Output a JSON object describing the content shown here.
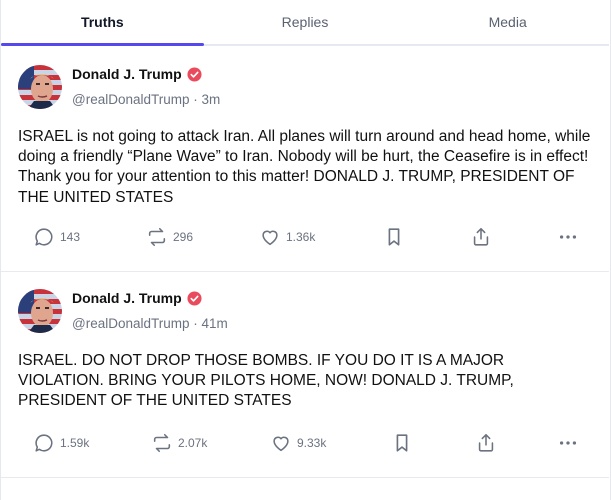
{
  "tabs": [
    {
      "label": "Truths",
      "active": true
    },
    {
      "label": "Replies",
      "active": false
    },
    {
      "label": "Media",
      "active": false
    }
  ],
  "posts": [
    {
      "author": "Donald J. Trump",
      "handle": "@realDonaldTrump",
      "time": "3m",
      "text": "ISRAEL is not going to attack Iran. All planes will turn around and head home, while doing a friendly “Plane Wave” to Iran. Nobody will be hurt, the Ceasefire is in effect! Thank you for your attention to this matter! DONALD J. TRUMP, PRESIDENT OF THE UNITED STATES",
      "replies": "143",
      "retruths": "296",
      "likes": "1.36k"
    },
    {
      "author": "Donald J. Trump",
      "handle": "@realDonaldTrump",
      "time": "41m",
      "text": "ISRAEL. DO NOT DROP THOSE BOMBS. IF YOU DO IT IS A MAJOR VIOLATION. BRING YOUR PILOTS HOME, NOW!  DONALD J. TRUMP, PRESIDENT OF THE UNITED STATES",
      "replies": "1.59k",
      "retruths": "2.07k",
      "likes": "9.33k"
    }
  ],
  "colors": {
    "accent": "#5448ee",
    "verified": "#e94b5c",
    "muted": "#6b7280"
  },
  "icons": [
    "reply-icon",
    "retruth-icon",
    "heart-icon",
    "bookmark-icon",
    "share-icon",
    "more-icon",
    "verified-badge-icon"
  ]
}
